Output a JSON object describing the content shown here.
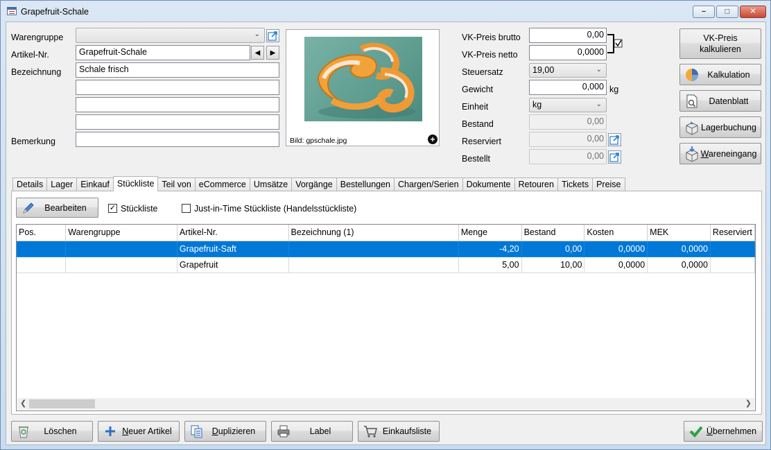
{
  "window": {
    "title": "Grapefruit-Schale"
  },
  "form": {
    "warengruppe_label": "Warengruppe",
    "warengruppe_value": "",
    "artikelnr_label": "Artikel-Nr.",
    "artikelnr_value": "Grapefruit-Schale",
    "bezeichnung_label": "Bezeichnung",
    "bezeichnung_value": "Schale frisch",
    "bezeichnung_extra": [
      "",
      "",
      ""
    ],
    "bemerkung_label": "Bemerkung",
    "bemerkung_value": ""
  },
  "image": {
    "caption": "Bild: gpschale.jpg"
  },
  "prices": {
    "vk_brutto_label": "VK-Preis brutto",
    "vk_brutto_value": "0,00",
    "vk_netto_label": "VK-Preis netto",
    "vk_netto_value": "0,0000",
    "steuersatz_label": "Steuersatz",
    "steuersatz_value": "19,00",
    "gewicht_label": "Gewicht",
    "gewicht_value": "0,000",
    "gewicht_unit": "kg",
    "einheit_label": "Einheit",
    "einheit_value": "kg",
    "bestand_label": "Bestand",
    "bestand_value": "0,00",
    "reserviert_label": "Reserviert",
    "reserviert_value": "0,00",
    "bestellt_label": "Bestellt",
    "bestellt_value": "0,00"
  },
  "side_buttons": {
    "vk_kalk_line1": "VK-Preis",
    "vk_kalk_line2": "kalkulieren",
    "kalkulation": "Kalkulation",
    "datenblatt": "Datenblatt",
    "lagerbuchung": "Lagerbuchung",
    "wareneingang_u": "W",
    "wareneingang_rest": "areneingang"
  },
  "tabs": [
    "Details",
    "Lager",
    "Einkauf",
    "Stückliste",
    "Teil von",
    "eCommerce",
    "Umsätze",
    "Vorgänge",
    "Bestellungen",
    "Chargen/Serien",
    "Dokumente",
    "Retouren",
    "Tickets",
    "Preise"
  ],
  "active_tab": "Stückliste",
  "stueckliste": {
    "edit_button": "Bearbeiten",
    "chk_stueckliste_label": "Stückliste",
    "chk_stueckliste_checked": true,
    "chk_jit_label": "Just-in-Time Stückliste (Handelsstückliste)",
    "chk_jit_checked": false,
    "columns": [
      "Pos.",
      "Warengruppe",
      "Artikel-Nr.",
      "Bezeichnung (1)",
      "Menge",
      "Bestand",
      "Kosten",
      "MEK",
      "Reserviert"
    ],
    "rows": [
      {
        "pos": "",
        "warengruppe": "",
        "artikelnr": "Grapefruit-Saft",
        "bezeichnung": "",
        "menge": "-4,20",
        "bestand": "0,00",
        "kosten": "0,0000",
        "mek": "0,0000",
        "reserviert": "",
        "selected": true
      },
      {
        "pos": "",
        "warengruppe": "",
        "artikelnr": "Grapefruit",
        "bezeichnung": "",
        "menge": "5,00",
        "bestand": "10,00",
        "kosten": "0,0000",
        "mek": "0,0000",
        "reserviert": "",
        "selected": false
      }
    ]
  },
  "footer": {
    "loeschen": "Löschen",
    "neuer_artikel_u": "N",
    "neuer_artikel_rest": "euer Artikel",
    "duplizieren_u": "D",
    "duplizieren_rest": "uplizieren",
    "label": "Label",
    "einkaufsliste": "Einkaufsliste",
    "uebernehmen_u": "Ü",
    "uebernehmen_rest": "bernehmen"
  },
  "colors": {
    "selection": "#0078d7",
    "accent_check": "#2ea043",
    "link_icon": "#2a7fd0"
  }
}
